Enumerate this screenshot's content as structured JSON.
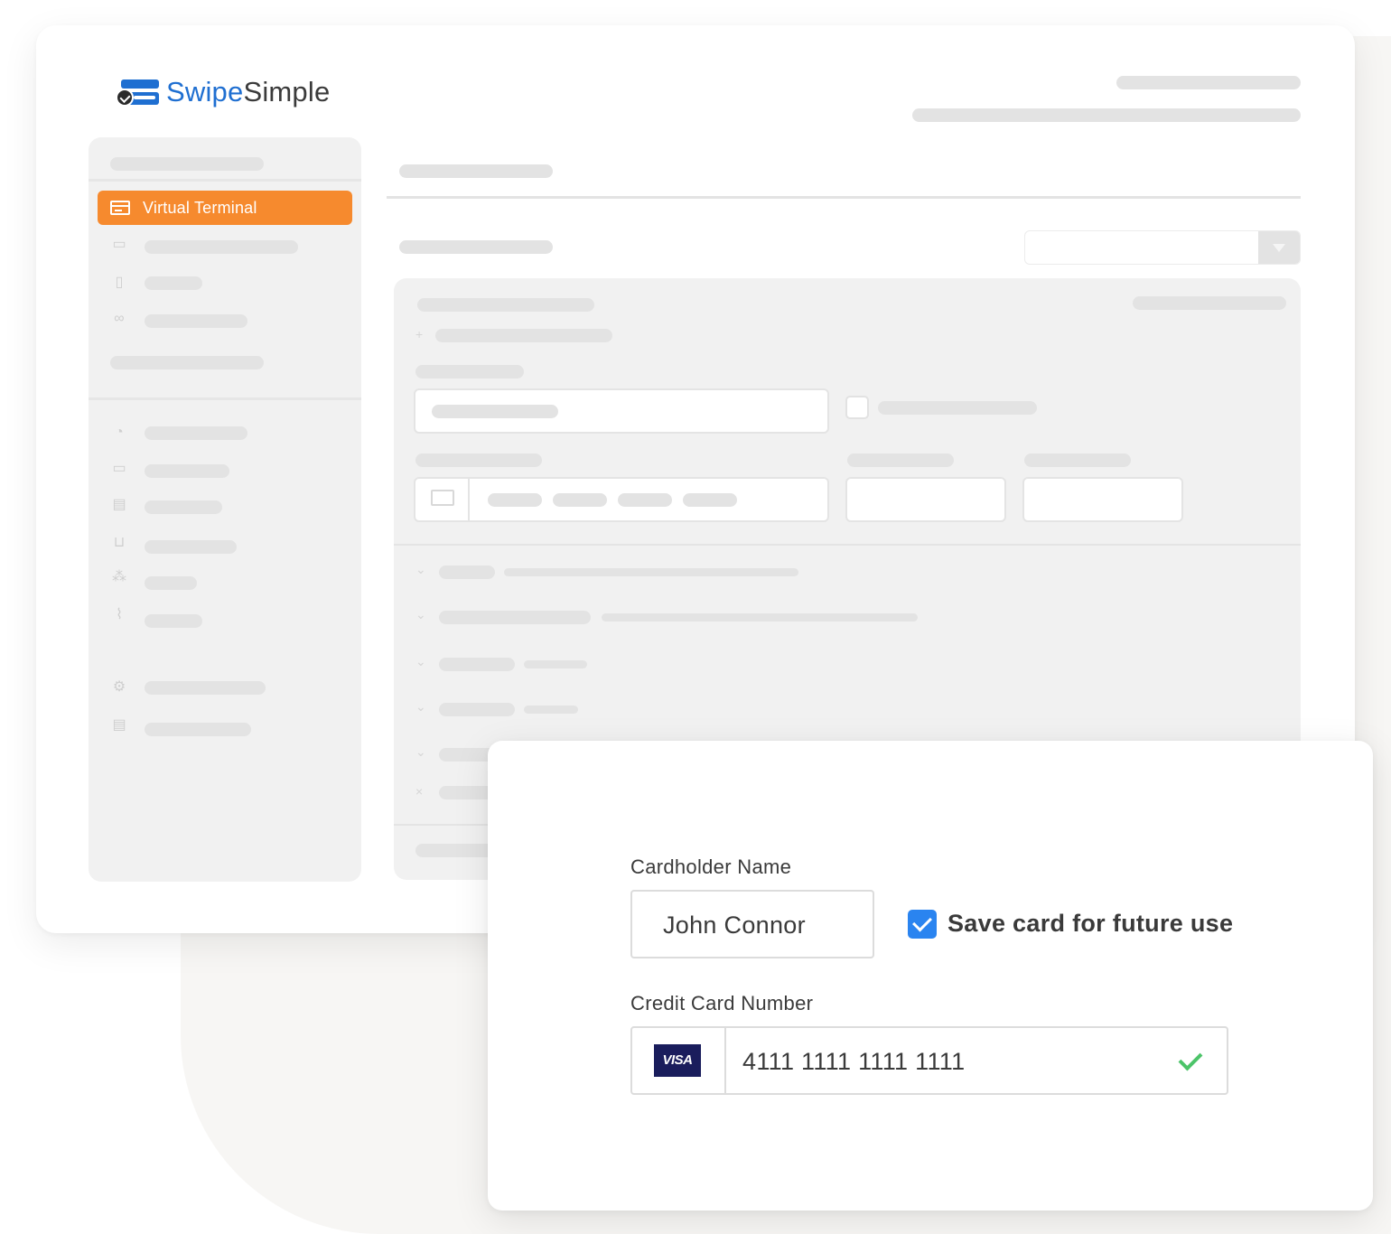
{
  "brand": {
    "name_part1": "Swipe",
    "name_part2": "Simple"
  },
  "sidebar": {
    "active_item": {
      "label": "Virtual Terminal",
      "icon": "credit-card-icon"
    },
    "icons": [
      "calendar-icon",
      "document-icon",
      "link-icon",
      "dashboard-icon",
      "cash-icon",
      "id-card-icon",
      "cart-icon",
      "users-icon",
      "chart-icon",
      "gear-icon",
      "book-icon"
    ]
  },
  "payment_form": {
    "cardholder_label": "Cardholder Name",
    "cardholder_value": "John Connor",
    "save_card_label": "Save card for future use",
    "save_card_checked": true,
    "card_number_label": "Credit Card Number",
    "card_number_value": "4111 1111 1111 1111",
    "card_brand": "VISA",
    "card_valid": true
  },
  "colors": {
    "accent": "#f68a2e",
    "brand_blue": "#1f6fd1",
    "checkbox_blue": "#2a84f0",
    "valid_green": "#4cc469",
    "visa_navy": "#1a1d5c"
  }
}
